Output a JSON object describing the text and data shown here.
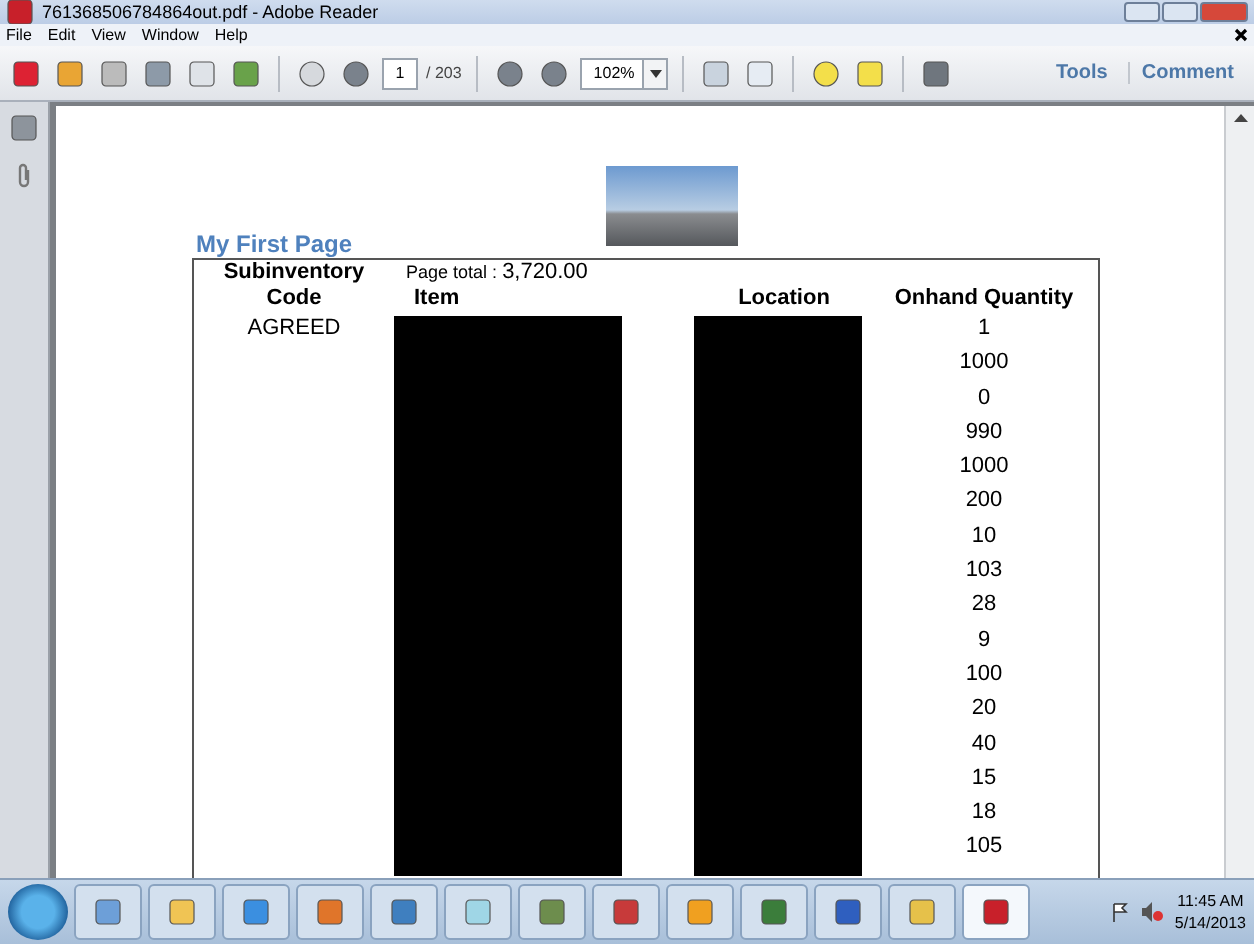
{
  "window": {
    "title": "761368506784864out.pdf - Adobe Reader"
  },
  "menu": [
    "File",
    "Edit",
    "View",
    "Window",
    "Help"
  ],
  "toolbar": {
    "page": "1",
    "page_count": "/ 203",
    "zoom": "102%",
    "links": [
      "Tools",
      "Comment"
    ]
  },
  "document": {
    "heading": "My First Page",
    "table": {
      "page_total_label": "Page total :",
      "page_total": "3,720.00",
      "columns": [
        "Subinventory Code",
        "Item",
        "Location",
        "Onhand Quantity"
      ],
      "subinventory": "AGREED",
      "quantities": [
        "1",
        "1000",
        "0",
        "990",
        "1000",
        "200",
        "10",
        "103",
        "28",
        "9",
        "100",
        "20",
        "40",
        "15",
        "18",
        "105"
      ]
    }
  },
  "taskbar": {
    "time": "11:45 AM",
    "date": "5/14/2013"
  }
}
